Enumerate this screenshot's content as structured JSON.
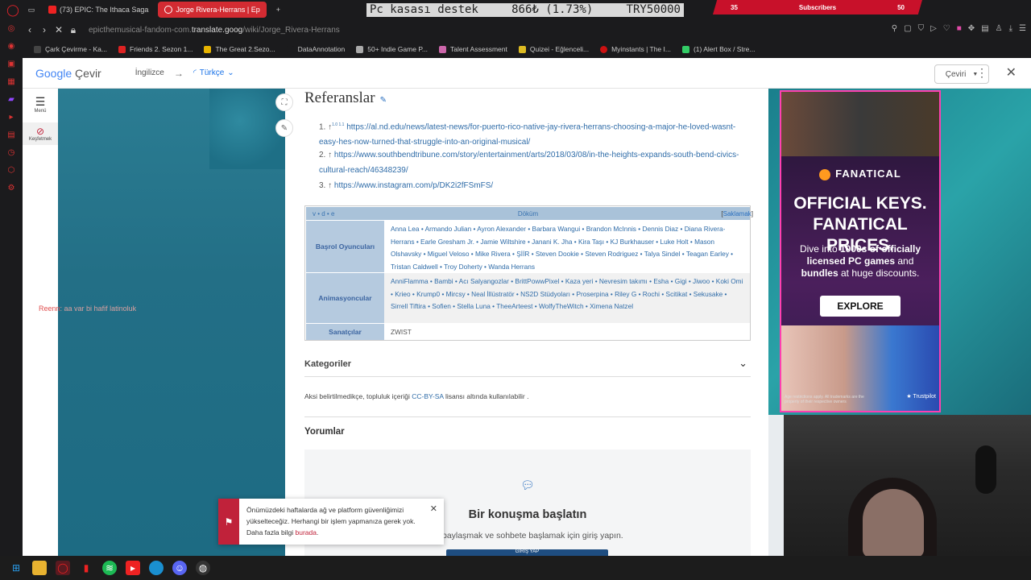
{
  "browser": {
    "tabs": [
      {
        "label": "(73) EPIC: The Ithaca Saga",
        "active": false
      },
      {
        "label": "Jorge Rivera-Herrans | Ep",
        "active": true
      }
    ],
    "new_tab": "+",
    "url_prefix": "epicthemusical-fandom-com.",
    "url_domain": "translate.goog",
    "url_path": "/wiki/Jorge_Rivera-Herrans",
    "bookmarks": [
      "Çark Çevirme - Ka...",
      "Friends 2. Sezon 1...",
      "The Great 2.Sezo...",
      "DataAnnotation",
      "50+ Indie Game P...",
      "Talent Assessment",
      "Quizei - Eğlenceli...",
      "Myinstants | The I...",
      "(1) Alert Box / Stre..."
    ]
  },
  "stream_overlay": {
    "left": "Pc kasası destek",
    "amount": "866₺ (1.73%)",
    "goal": "TRY50000",
    "subs_left": "35",
    "subs_label": "Subscribers",
    "subs_right": "50"
  },
  "translate_bar": {
    "logo_google": "Google",
    "logo_cevir": "Çevir",
    "source_lang": "İngilizce",
    "arrow": "→",
    "target_lang": "Türkçe",
    "translate_btn": "Çeviri"
  },
  "rail": {
    "menu_label": "Menü",
    "explore_label": "Keşfetmek"
  },
  "side_text": {
    "name": "Reenn",
    "rest": ": aa var bi hafif latinoluk"
  },
  "references": {
    "title": "Referanslar",
    "items": [
      {
        "prefix": "1. ↑",
        "sup": "1.0 1.1",
        "url": "https://al.nd.edu/news/latest-news/for-puerto-rico-native-jay-rivera-herrans-choosing-a-major-he-loved-wasnt-easy-hes-now-turned-that-struggle-into-an-original-musical/"
      },
      {
        "prefix": "2. ↑",
        "sup": "",
        "url": "https://www.southbendtribune.com/story/entertainment/arts/2018/03/08/in-the-heights-expands-south-bend-civics-cultural-reach/46348239/"
      },
      {
        "prefix": "3. ↑",
        "sup": "",
        "url": "https://www.instagram.com/p/DK2i2fFSmFS/"
      }
    ]
  },
  "navbox": {
    "vde": "v • d • e",
    "title": "Döküm",
    "hide_open": "[",
    "hide": "Saklamak",
    "hide_close": "]",
    "rows": [
      {
        "label": "Başrol Oyuncuları",
        "list": "Anna Lea • Armando Julian • Ayron Alexander • Barbara Wangui • Brandon McInnis • Dennis Diaz • Diana Rivera-Herrans • Earle Gresham Jr. • Jamie Wiltshire • Janani K. Jha • Kira Taşı • KJ Burkhauser • Luke Holt • Mason Olshavsky • Miguel Veloso • Mike Rivera • ŞİİR • Steven Dookie • Steven Rodriguez • Talya Sindel • Teagan Earley • Tristan Caldwell • Troy Doherty • Wanda Herrans"
      },
      {
        "label": "Animasyoncular",
        "list": "AnniFlamma • Bambi • Acı Salyangozlar • BrittPowwPixel • Kaza yeri • Nevresim takımı • Esha • Gigi • Jiwoo • Koki Omi • Krieo • Krump0 • Mircsy • Neal İllüstratör • NS2D Stüdyoları • Proserpina • Riley G • Rochi • Scitikat • Sekusake • Sirrell Tiftira • Sofien • Stella Luna • TheeArteest • WolfyTheWitch • Ximena Natzel"
      },
      {
        "label": "Sanatçılar",
        "list": "ZWIST"
      }
    ]
  },
  "categories_label": "Kategoriler",
  "license": {
    "before": "Aksi belirtilmedikçe, topluluk içeriği ",
    "link": "CC-BY-SA",
    "after": " lisansı altında kullanılabilir ."
  },
  "comments": {
    "title": "Yorumlar",
    "cta_title": "Bir konuşma başlatın",
    "cta_sub": "inizi paylaşmak ve sohbete başlamak için giriş yapın.",
    "button": "GİRİŞ YAP"
  },
  "toast": {
    "message": "Önümüzdeki haftalarda ağ ve platform güvenliğimizi yükselteceğiz. Herhangi bir işlem yapmanıza gerek yok. Daha fazla bilgi ",
    "link": "burada",
    "end": "."
  },
  "ad": {
    "brand": "FANATICAL",
    "headline1": "OFFICIAL KEYS.",
    "headline2": "FANATICAL PRICES.",
    "body_pre": "Dive into ",
    "body_b1": "1000s of officially licensed PC games",
    "body_mid": " and ",
    "body_b2": "bundles",
    "body_post": " at huge discounts.",
    "cta": "EXPLORE",
    "foot": "Age restrictions apply. All trademarks are the property of their respective owners",
    "trustpilot": "★ Trustpilot"
  },
  "colors": {
    "accent_red": "#d32b32",
    "link_blue": "#2f6ca8",
    "teal": "#236f86"
  }
}
